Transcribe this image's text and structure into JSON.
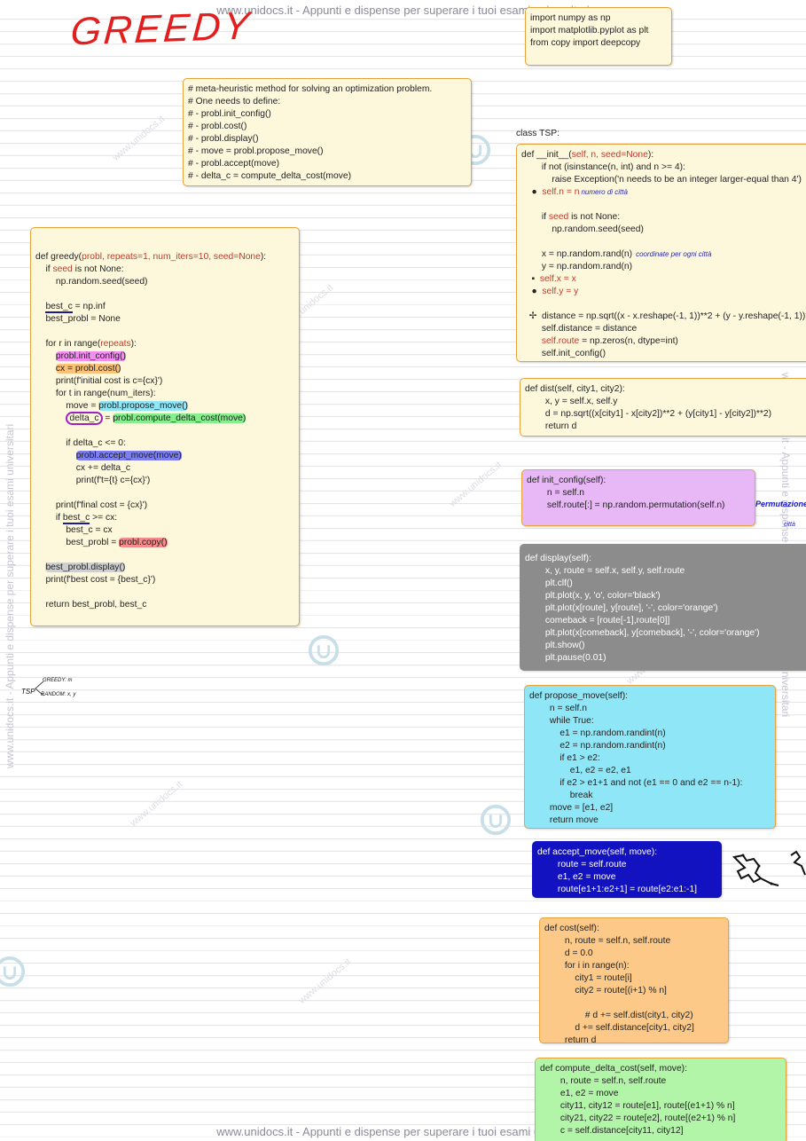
{
  "watermark": {
    "text": "www.unidocs.it - Appunti e dispense per superare i tuoi esami universitari",
    "diag": "www.unidocs.it",
    "side": "www.unidocs.it - Appunti e dispense per superare i tuoi esami universitari"
  },
  "title": "GREEDY",
  "imports": {
    "lines": [
      "import numpy as np",
      "import matplotlib.pyplot as plt",
      "from copy import deepcopy"
    ]
  },
  "comment": {
    "lines": [
      "# meta-heuristic method for solving an optimization problem.",
      "# One needs to define:",
      "# - probl.init_config()",
      "# - probl.cost()",
      "# - probl.display()",
      "# - move = probl.propose_move()",
      "# - probl.accept(move)",
      "# - delta_c = compute_delta_cost(move)"
    ]
  },
  "greedy": {
    "def_head": "def greedy(",
    "def_params": "probl, repeats=1, num_iters=10, seed=None",
    "def_tail": "):",
    "if_seed_a": "    if ",
    "if_seed_b": "seed",
    "if_seed_c": " is not None:",
    "seed_call": "        np.random.seed(seed)",
    "best_c_name": "best_c",
    "best_c_rest": " = np.inf",
    "best_probl_none": "    best_probl = None",
    "for_r_a": "    for r in range(",
    "for_r_b": "repeats",
    "for_r_c": "):",
    "init_config": "probl.init_config()",
    "cx_cost": "cx = probl.cost()",
    "print_initial": "        print(f'initial cost is c={cx}')",
    "for_t": "        for t in range(num_iters):",
    "move_a": "            move = ",
    "move_b": "probl.propose_move()",
    "delta_a": "delta_c",
    "delta_b": " = ",
    "delta_c": "probl.compute_delta_cost(move)",
    "if_delta": "            if delta_c <= 0:",
    "accept_move": "probl.accept_move(move)",
    "cx_plus": "                cx += delta_c",
    "print_t": "                print(f't={t} c={cx}')",
    "print_final": "        print(f'final cost = {cx}')",
    "if_best_a": "        if ",
    "if_best_b": "best_c",
    "if_best_c": " >= cx:",
    "best_c_cx": "            best_c = cx",
    "best_probl_a": "            best_probl = ",
    "best_probl_b": "probl.copy()",
    "display": "best_probl.display()",
    "print_best": "    print(f'best cost = {best_c}')",
    "return": "    return best_probl, best_c"
  },
  "tsp_class_label": "class TSP:",
  "tsp_init": {
    "def_head": "def __init__(",
    "def_params": "self, n, seed=None",
    "def_tail": "):",
    "lines_a": [
      "        if not (isinstance(n, int) and n >= 4):",
      "            raise Exception('n needs to be an integer larger-equal than 4')"
    ],
    "self_n": "self.n = n",
    "if_seed_a": "        if ",
    "if_seed_b": "seed",
    "if_seed_c": " is not None:",
    "seed_call": "            np.random.seed(seed)",
    "x_line": "        x = np.random.rand(n)",
    "y_line": "        y = np.random.rand(n)",
    "self_x": "self.x = x",
    "self_y": "self.y = y",
    "distance_line": "distance = np.sqrt((x - x.reshape(-1, 1))**2 + (y - y.reshape(-1, 1))**2)",
    "self_distance": "        self.distance = distance",
    "self_route_a": "self.route",
    "self_route_b": " = np.zeros(n, dtype=int)",
    "init_config_call": "        self.init_config()"
  },
  "annotations": {
    "n_note": "numero di città",
    "xy_note": "coordinate per ogni città",
    "tsp_label": "TSP",
    "tsp_branch_1": "GREEDY: m",
    "tsp_branch_2": "RANDOM: x, y",
    "perm_note": "Permutazione",
    "perm_note2": "città"
  },
  "dist": {
    "lines": [
      "def dist(self, city1, city2):",
      "        x, y = self.x, self.y",
      "        d = np.sqrt((x[city1] - x[city2])**2 + (y[city1] - y[city2])**2)",
      "        return d"
    ]
  },
  "init_config": {
    "lines": [
      "def init_config(self):",
      "        n = self.n",
      "        self.route[:] = np.random.permutation(self.n)"
    ]
  },
  "display_fn": {
    "lines": [
      "def display(self):",
      "        x, y, route = self.x, self.y, self.route",
      "        plt.clf()",
      "        plt.plot(x, y, 'o', color='black')",
      "        plt.plot(x[route], y[route], '-', color='orange')",
      "        comeback = [route[-1],route[0]]",
      "        plt.plot(x[comeback], y[comeback], '-', color='orange')",
      "        plt.show()",
      "        plt.pause(0.01)"
    ]
  },
  "propose_move": {
    "lines": [
      "def propose_move(self):",
      "        n = self.n",
      "        while True:",
      "            e1 = np.random.randint(n)",
      "            e2 = np.random.randint(n)",
      "            if e1 > e2:",
      "                e1, e2 = e2, e1",
      "            if e2 > e1+1 and not (e1 == 0 and e2 == n-1):",
      "                break",
      "        move = [e1, e2]",
      "        return move"
    ]
  },
  "accept_move": {
    "lines": [
      "def accept_move(self, move):",
      "        route = self.route",
      "        e1, e2 = move",
      "        route[e1+1:e2+1] = route[e2:e1:-1]"
    ]
  },
  "cost": {
    "lines": [
      "def cost(self):",
      "        n, route = self.n, self.route",
      "        d = 0.0",
      "        for i in range(n):",
      "            city1 = route[i]",
      "            city2 = route[(i+1) % n]",
      "",
      "                # d += self.dist(city1, city2)",
      "            d += self.distance[city1, city2]",
      "        return d"
    ]
  },
  "compute_delta": {
    "lines": [
      "def compute_delta_cost(self, move):",
      "        n, route = self.n, self.route",
      "        e1, e2 = move",
      "        city11, city12 = route[e1], route[(e1+1) % n]",
      "        city21, city22 = route[e2], route[(e2+1) % n]",
      "        c = self.distance[city11, city12]"
    ]
  },
  "colors": {
    "title_red": "#e11f1f",
    "box_border": "#e6a23c",
    "yellow": "#fdf8dc",
    "purple": "#e7b8f5",
    "gray": "#8c8c8c",
    "cyan": "#8ee6f6",
    "blue": "#1212c0",
    "orange": "#fcc988",
    "green": "#b3f5a8"
  }
}
